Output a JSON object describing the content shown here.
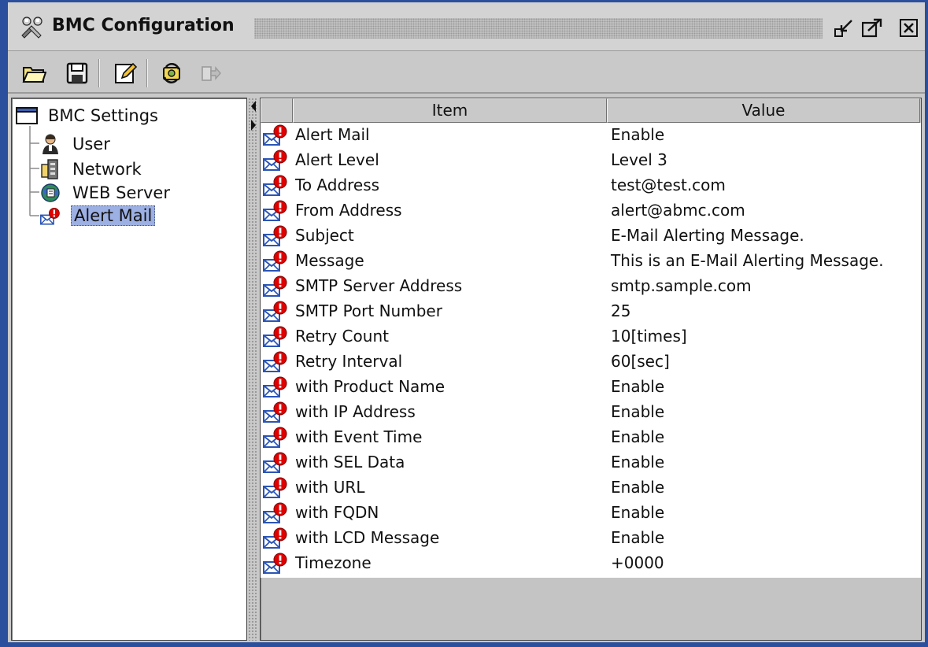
{
  "window": {
    "title": "BMC Configuration"
  },
  "toolbar": {
    "icons": [
      "folder-open-icon",
      "save-icon",
      "edit-icon",
      "refresh-icon",
      "exit-icon"
    ]
  },
  "tree": {
    "root": "BMC Settings",
    "children": [
      {
        "label": "User",
        "icon": "user-icon"
      },
      {
        "label": "Network",
        "icon": "network-icon"
      },
      {
        "label": "WEB Server",
        "icon": "web-server-icon"
      },
      {
        "label": "Alert Mail",
        "icon": "alert-mail-icon",
        "selected": true
      }
    ]
  },
  "table": {
    "headers": {
      "item": "Item",
      "value": "Value"
    },
    "rows": [
      {
        "item": "Alert Mail",
        "value": "Enable"
      },
      {
        "item": "Alert Level",
        "value": "Level 3"
      },
      {
        "item": "To Address",
        "value": "test@test.com"
      },
      {
        "item": "From Address",
        "value": "alert@abmc.com"
      },
      {
        "item": "Subject",
        "value": "E-Mail Alerting Message."
      },
      {
        "item": "Message",
        "value": "This is an E-Mail Alerting Message."
      },
      {
        "item": "SMTP Server Address",
        "value": "smtp.sample.com"
      },
      {
        "item": "SMTP Port Number",
        "value": "25"
      },
      {
        "item": "Retry Count",
        "value": "10[times]"
      },
      {
        "item": "Retry Interval",
        "value": "60[sec]"
      },
      {
        "item": "with Product Name",
        "value": "Enable"
      },
      {
        "item": "with IP Address",
        "value": "Enable"
      },
      {
        "item": "with Event Time",
        "value": "Enable"
      },
      {
        "item": "with SEL Data",
        "value": "Enable"
      },
      {
        "item": "with URL",
        "value": "Enable"
      },
      {
        "item": "with FQDN",
        "value": "Enable"
      },
      {
        "item": "with LCD Message",
        "value": "Enable"
      },
      {
        "item": "Timezone",
        "value": "+0000"
      }
    ]
  },
  "colors": {
    "frame": "#2b4f9d",
    "selection": "#9db0e4",
    "alert_badge": "#e00000"
  }
}
